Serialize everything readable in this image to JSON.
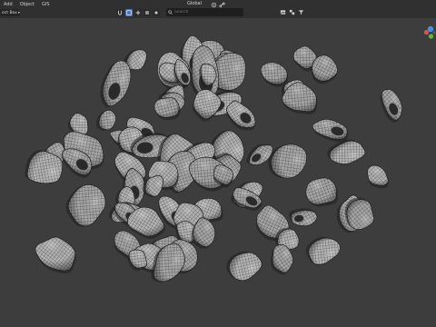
{
  "header": {
    "menu": [
      "Add",
      "Object",
      "GIS"
    ],
    "mode_select": "ect Box",
    "search_placeholder": "Search",
    "orientation": "Global"
  },
  "icons": {
    "snap": [
      "magnet-icon",
      "box-select-icon",
      "grid-icon",
      "snap-face-icon",
      "snap-vertex-icon"
    ],
    "pivot": [
      "pivot-icon",
      "link-icon"
    ],
    "right_tools": [
      "image-icon",
      "overlay-icon",
      "filter-icon"
    ]
  },
  "colors": {
    "viewport_bg": "#3d3d3d",
    "header_bg": "#303030",
    "accent": "#4772b3",
    "mesh_fill": "#b9b9b9",
    "mesh_wire": "#2a2a2a",
    "gizmo_x": "#e34e4e",
    "gizmo_y": "#65b83a",
    "gizmo_z": "#4a8ee0"
  }
}
